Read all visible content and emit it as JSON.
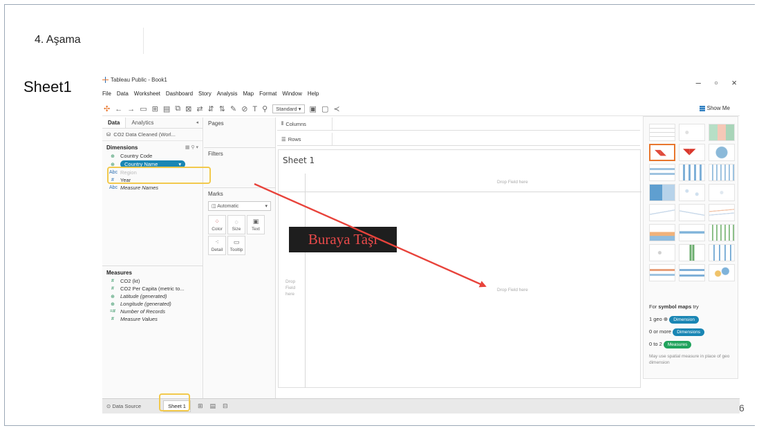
{
  "slide": {
    "stage_title": "4. Aşama",
    "sheet_heading": "Sheet1",
    "page_number": "6",
    "callout": "Buraya Taşı",
    "highlight_color": "#f2c94c",
    "arrow_color": "#e8433b"
  },
  "window": {
    "title": "Tableau Public - Book1",
    "controls": {
      "minimize": "–",
      "maximize": "▫",
      "close": "×"
    },
    "menu": [
      "File",
      "Data",
      "Worksheet",
      "Dashboard",
      "Story",
      "Analysis",
      "Map",
      "Format",
      "Window",
      "Help"
    ],
    "toolbar": {
      "fit_select": "Standard",
      "show_me": "Show Me"
    }
  },
  "data_pane": {
    "tabs": {
      "data": "Data",
      "analytics": "Analytics"
    },
    "datasource": "CO2 Data Cleaned (Worl...",
    "dimensions_label": "Dimensions",
    "dimensions": [
      {
        "icon": "globe",
        "label": "Country Code"
      },
      {
        "icon": "globe",
        "label": "Country Name",
        "selected": true
      },
      {
        "icon": "abc",
        "label": "Region"
      },
      {
        "icon": "number",
        "label": "Year"
      },
      {
        "icon": "abc",
        "label": "Measure Names",
        "italic": true
      }
    ],
    "measures_label": "Measures",
    "measures": [
      {
        "icon": "#",
        "label": "CO2 (kt)"
      },
      {
        "icon": "#",
        "label": "CO2 Per Capita (metric to..."
      },
      {
        "icon": "globe",
        "label": "Latitude (generated)",
        "italic": true
      },
      {
        "icon": "globe",
        "label": "Longitude (generated)",
        "italic": true
      },
      {
        "icon": "=#",
        "label": "Number of Records",
        "italic": true
      },
      {
        "icon": "#",
        "label": "Measure Values",
        "italic": true
      }
    ]
  },
  "shelves": {
    "pages": "Pages",
    "filters": "Filters",
    "marks": "Marks",
    "marks_type": "Automatic",
    "mark_buttons": [
      "Color",
      "Size",
      "Text",
      "Detail",
      "Tooltip"
    ],
    "columns": "Columns",
    "rows": "Rows"
  },
  "canvas": {
    "title": "Sheet 1",
    "drop_field": "Drop Field here",
    "drop_left": "Drop Field here"
  },
  "show_me": {
    "hint_title_prefix": "For ",
    "hint_title_bold": "symbol maps",
    "hint_title_suffix": " try",
    "req1_prefix": "1 geo",
    "req1_pill": "Dimension",
    "req2_prefix": "0 or more",
    "req2_pill": "Dimensions",
    "req3_prefix": "0 to 2",
    "req3_pill": "Measures",
    "note": "May use spatial measure in place of geo dimension"
  },
  "tabs": {
    "data_source": "Data Source",
    "sheet": "Sheet 1"
  }
}
